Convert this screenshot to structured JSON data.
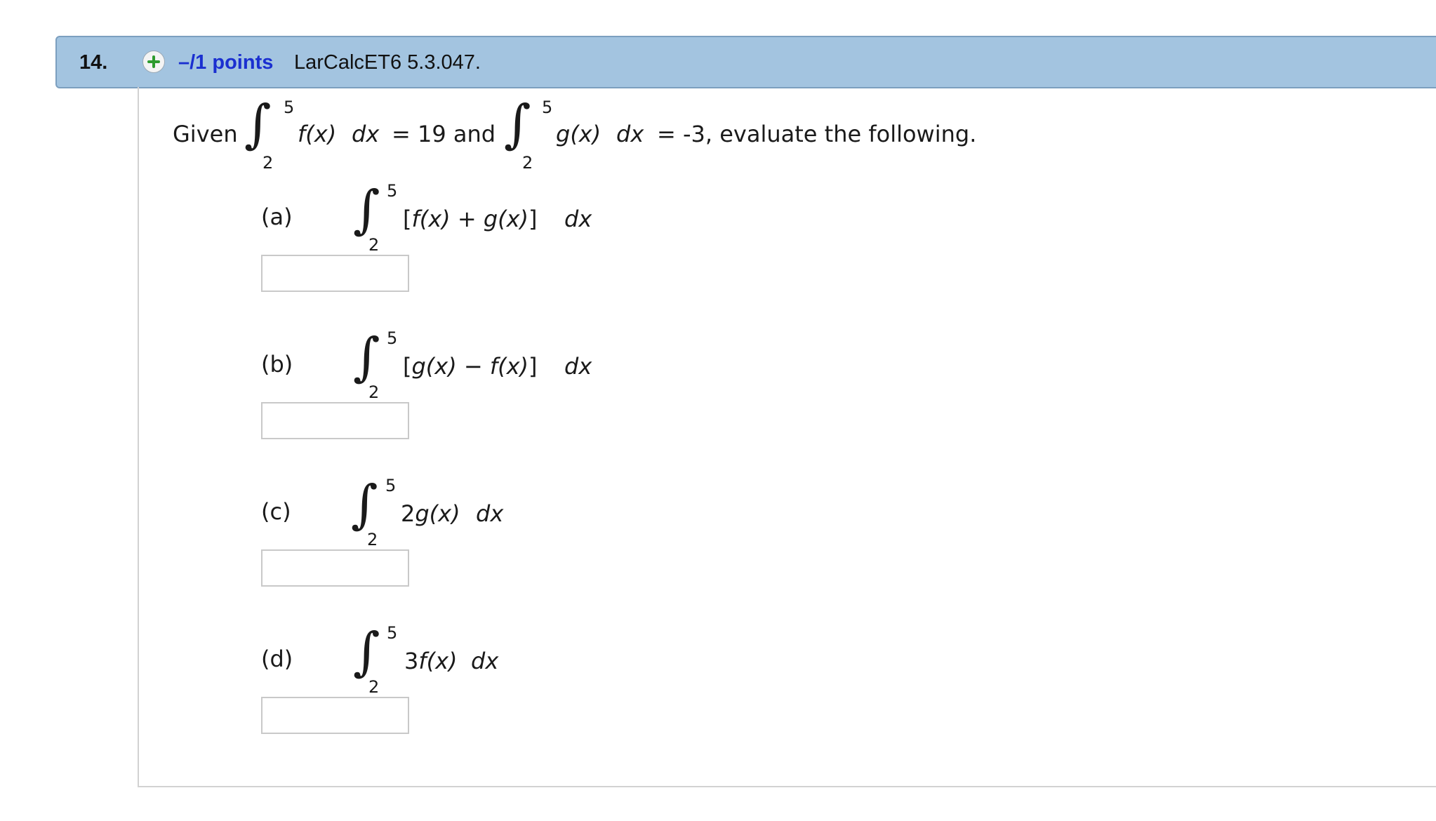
{
  "question": {
    "number": "14.",
    "points": "–/1 points",
    "code": "LarCalcET6 5.3.047."
  },
  "given": {
    "prefix": "Given",
    "f_upper": "5",
    "f_lower": "2",
    "f_integrand": "f(x)",
    "dx": "dx",
    "f_equals": "= 19 and",
    "g_upper": "5",
    "g_lower": "2",
    "g_integrand": "g(x)",
    "g_equals": "= -3, evaluate the following."
  },
  "parts": [
    {
      "label": "(a)",
      "upper": "5",
      "lower": "2",
      "open": "[",
      "t1": "f(x)",
      "op": " + ",
      "t2": "g(x)",
      "close": "]",
      "dx": "dx",
      "answer": ""
    },
    {
      "label": "(b)",
      "upper": "5",
      "lower": "2",
      "open": "[",
      "t1": "g(x)",
      "op": " − ",
      "t2": "f(x)",
      "close": "]",
      "dx": "dx",
      "answer": ""
    },
    {
      "label": "(c)",
      "upper": "5",
      "lower": "2",
      "coef": "2",
      "t1": "g(x)",
      "dx": "dx",
      "answer": ""
    },
    {
      "label": "(d)",
      "upper": "5",
      "lower": "2",
      "coef": "3",
      "t1": "f(x)",
      "dx": "dx",
      "answer": ""
    }
  ]
}
